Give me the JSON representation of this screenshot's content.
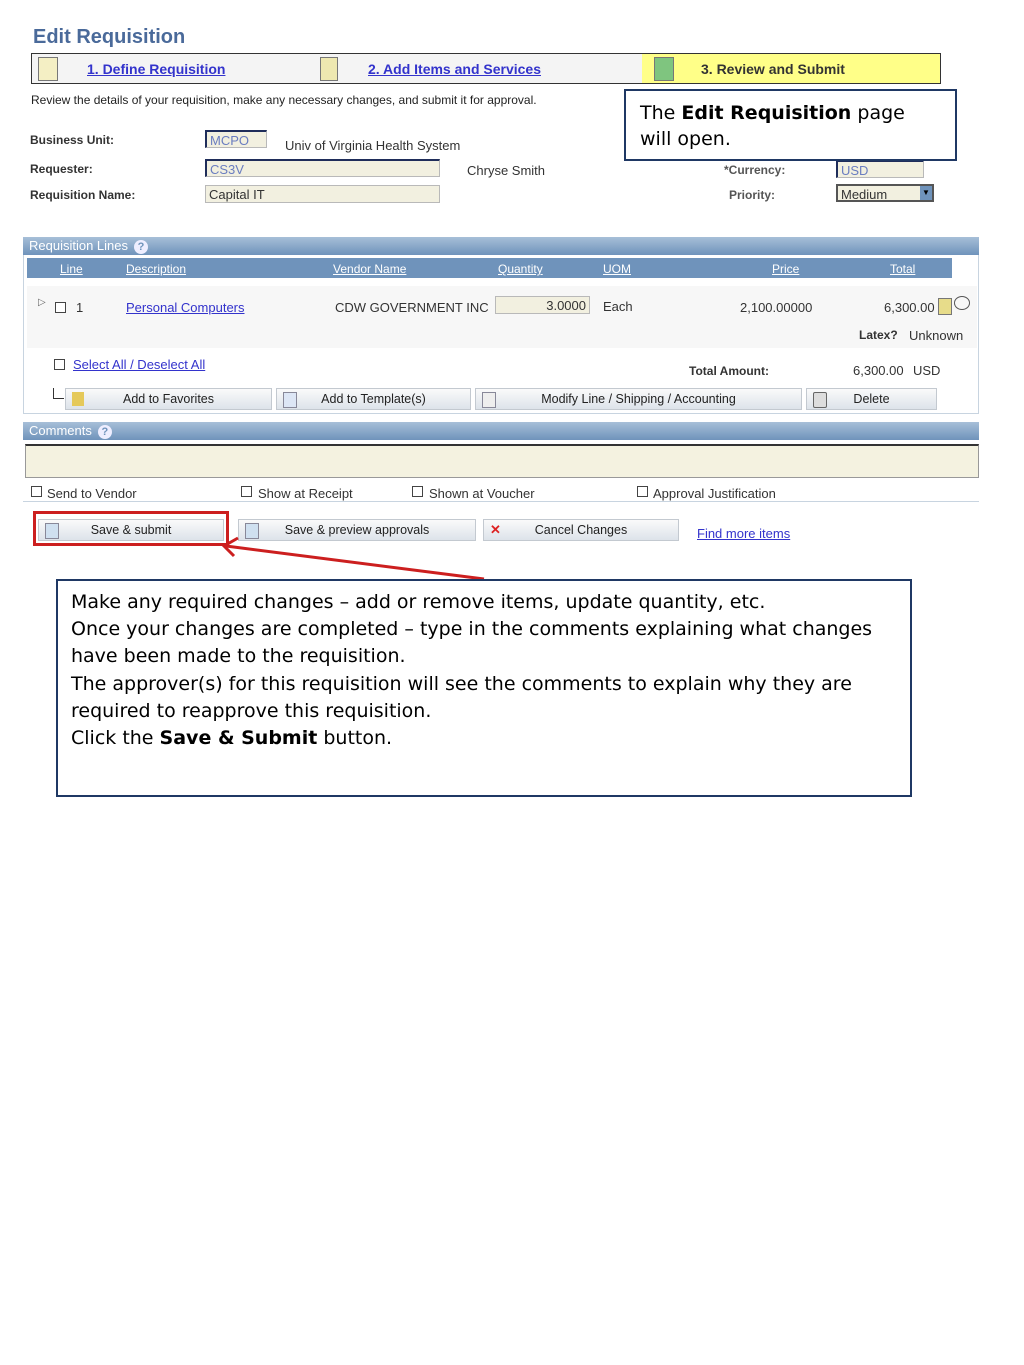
{
  "page_title": "Edit Requisition",
  "steps": [
    {
      "label": "1. Define Requisition",
      "icon": "define-requisition-icon"
    },
    {
      "label": "2. Add Items and Services",
      "icon": "add-items-icon"
    },
    {
      "label": "3. Review and Submit",
      "icon": "review-submit-icon",
      "active": true
    }
  ],
  "instructions": "Review the details of your requisition, make any necessary changes, and submit it for approval.",
  "form": {
    "business_unit_label": "Business Unit:",
    "business_unit": "MCPO",
    "business_unit_desc": "Univ of Virginia Health System",
    "requester_label": "Requester:",
    "requester": "CS3V",
    "requester_name": "Chryse Smith",
    "req_name_label": "Requisition Name:",
    "req_name": "Capital IT",
    "currency_label": "*Currency:",
    "currency": "USD",
    "priority_label": "Priority:",
    "priority": "Medium"
  },
  "lines": {
    "title": "Requisition Lines",
    "columns": [
      "Line",
      "Description",
      "Vendor Name",
      "Quantity",
      "UOM",
      "Price",
      "Total"
    ],
    "rows": [
      {
        "line": "1",
        "description": "Personal Computers",
        "vendor": "CDW GOVERNMENT INC",
        "quantity": "3.0000",
        "uom": "Each",
        "price": "2,100.00000",
        "total": "6,300.00",
        "latex_label": "Latex?",
        "latex": "Unknown"
      }
    ],
    "select_all": "Select All / Deselect All",
    "total_label": "Total Amount:",
    "total_amount": "6,300.00",
    "total_currency": "USD",
    "buttons": [
      "Add to Favorites",
      "Add to Template(s)",
      "Modify Line / Shipping / Accounting",
      "Delete"
    ]
  },
  "comments": {
    "title": "Comments",
    "value": "",
    "options": [
      "Send to Vendor",
      "Show at Receipt",
      "Shown at Voucher",
      "Approval Justification"
    ]
  },
  "actions": {
    "save_submit": "Save & submit",
    "save_preview": "Save & preview approvals",
    "cancel": "Cancel Changes",
    "find_more": "Find more items"
  },
  "callout_top": {
    "pre": "The ",
    "bold": "Edit Requisition",
    "post": " page will open."
  },
  "callout_bottom": {
    "line1": "Make any required changes – add or remove items, update quantity, etc.",
    "line2": "Once your changes are completed – type in the comments explaining what changes have been made to the requisition.",
    "line3": "The approver(s) for this requisition will see the comments to explain why they are required to reapprove this requisition.",
    "line4_pre": "Click the ",
    "line4_bold": "Save & Submit",
    "line4_post": " button."
  },
  "colors": {
    "accent": "#6f93bb",
    "highlight": "#cc1f1f",
    "step_active": "#ffff88"
  }
}
